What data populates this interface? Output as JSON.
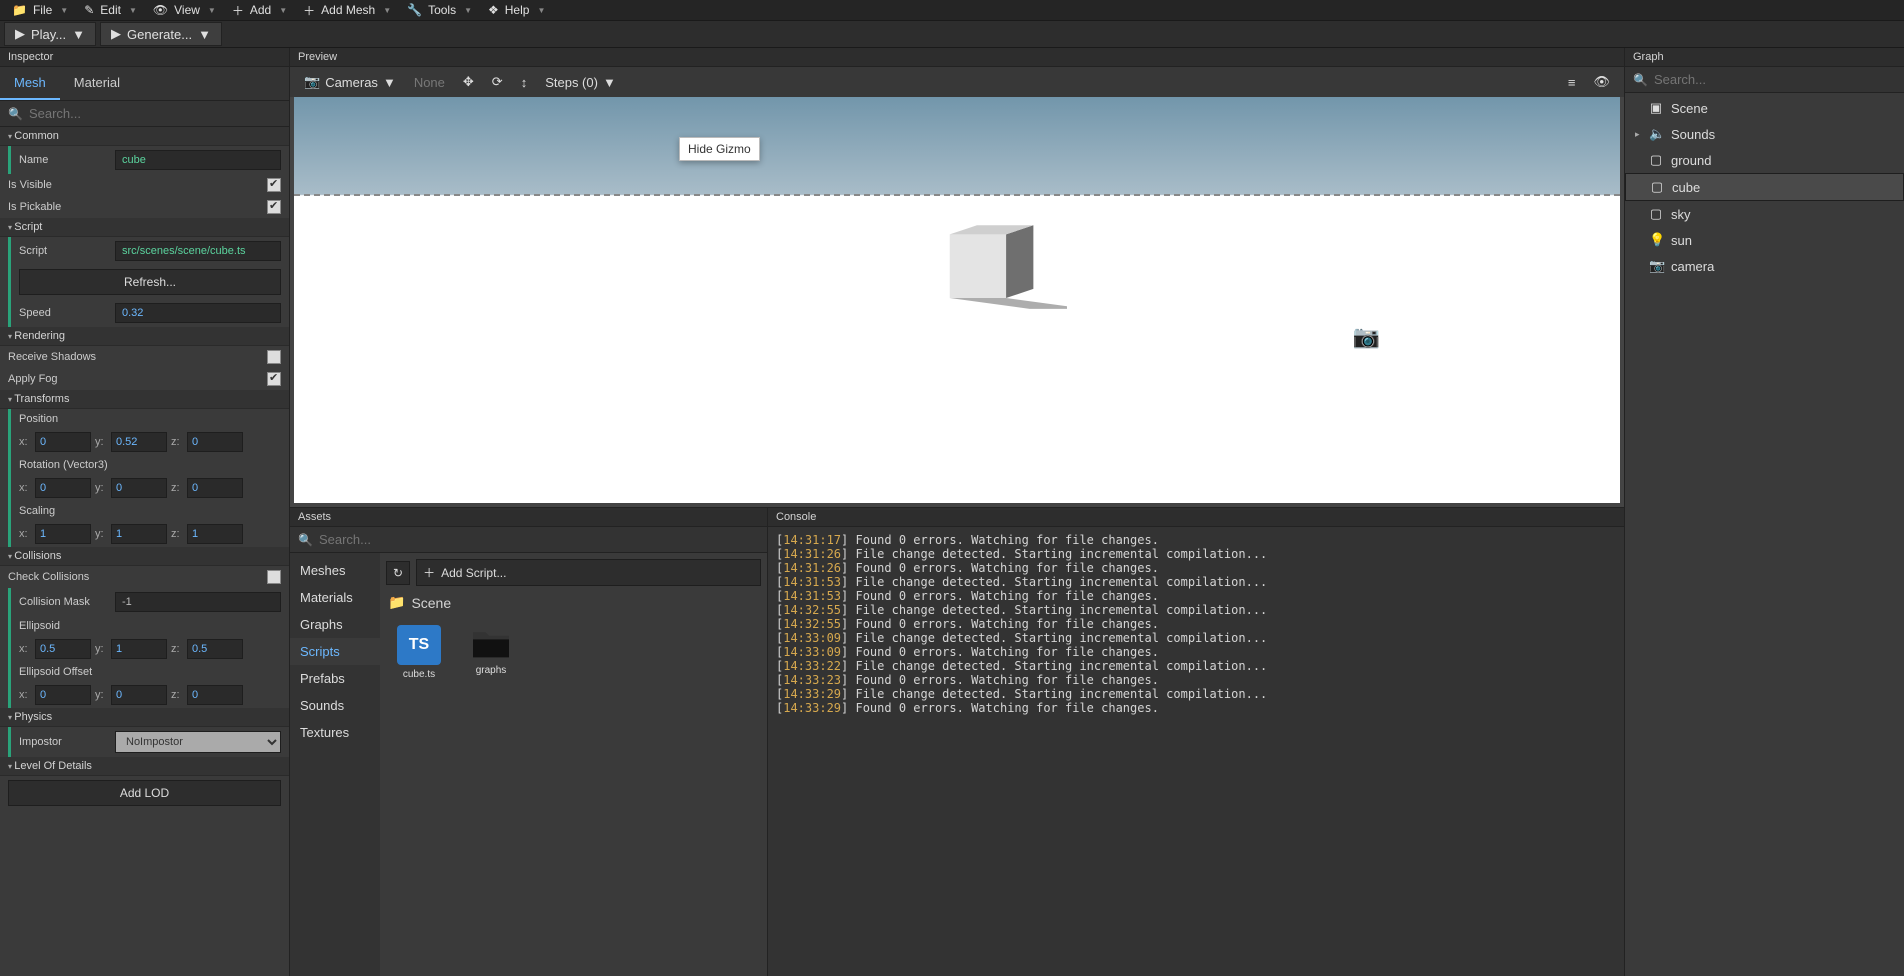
{
  "menu": {
    "file": "File",
    "edit": "Edit",
    "view": "View",
    "add": "Add",
    "addMesh": "Add Mesh",
    "tools": "Tools",
    "help": "Help",
    "play": "Play...",
    "generate": "Generate..."
  },
  "inspector": {
    "title": "Inspector",
    "tabs": {
      "mesh": "Mesh",
      "material": "Material"
    },
    "search": "Search...",
    "common": {
      "h": "Common",
      "name_l": "Name",
      "name": "cube",
      "isVisible": "Is Visible",
      "isPickable": "Is Pickable"
    },
    "script": {
      "h": "Script",
      "script_l": "Script",
      "script": "src/scenes/scene/cube.ts",
      "refresh": "Refresh...",
      "speed_l": "Speed",
      "speed": "0.32"
    },
    "rendering": {
      "h": "Rendering",
      "recvShadows": "Receive Shadows",
      "applyFog": "Apply Fog"
    },
    "transforms": {
      "h": "Transforms",
      "position": "Position",
      "rotation": "Rotation (Vector3)",
      "scaling": "Scaling",
      "pos": {
        "x": "0",
        "y": "0.52",
        "z": "0"
      },
      "rot": {
        "x": "0",
        "y": "0",
        "z": "0"
      },
      "scl": {
        "x": "1",
        "y": "1",
        "z": "1"
      }
    },
    "collisions": {
      "h": "Collisions",
      "check": "Check Collisions",
      "mask_l": "Collision Mask",
      "mask": "-1",
      "ellipsoid": "Ellipsoid",
      "ellipsoidOff": "Ellipsoid Offset",
      "ell": {
        "x": "0.5",
        "y": "1",
        "z": "0.5"
      },
      "elo": {
        "x": "0",
        "y": "0",
        "z": "0"
      }
    },
    "physics": {
      "h": "Physics",
      "impostor_l": "Impostor",
      "impostor": "NoImpostor"
    },
    "lod": {
      "h": "Level Of Details",
      "add": "Add LOD"
    }
  },
  "preview": {
    "title": "Preview",
    "cameras": "Cameras",
    "none": "None",
    "steps": "Steps (0)",
    "tooltip": "Hide Gizmo"
  },
  "assets": {
    "title": "Assets",
    "search": "Search...",
    "refresh": "↻",
    "addScript": "Add Script...",
    "cats": [
      "Meshes",
      "Materials",
      "Graphs",
      "Scripts",
      "Prefabs",
      "Sounds",
      "Textures"
    ],
    "breadcrumb": "Scene",
    "items": [
      {
        "name": "cube.ts",
        "type": "ts"
      },
      {
        "name": "graphs",
        "type": "folder"
      }
    ]
  },
  "console": {
    "title": "Console",
    "lines": [
      {
        "t": "14:31:17",
        "m": "Found 0 errors. Watching for file changes."
      },
      {
        "t": "14:31:26",
        "m": "File change detected. Starting incremental compilation..."
      },
      {
        "t": "14:31:26",
        "m": "Found 0 errors. Watching for file changes."
      },
      {
        "t": "14:31:53",
        "m": "File change detected. Starting incremental compilation..."
      },
      {
        "t": "14:31:53",
        "m": "Found 0 errors. Watching for file changes."
      },
      {
        "t": "14:32:55",
        "m": "File change detected. Starting incremental compilation..."
      },
      {
        "t": "14:32:55",
        "m": "Found 0 errors. Watching for file changes."
      },
      {
        "t": "14:33:09",
        "m": "File change detected. Starting incremental compilation..."
      },
      {
        "t": "14:33:09",
        "m": "Found 0 errors. Watching for file changes."
      },
      {
        "t": "14:33:22",
        "m": "File change detected. Starting incremental compilation..."
      },
      {
        "t": "14:33:23",
        "m": "Found 0 errors. Watching for file changes."
      },
      {
        "t": "14:33:29",
        "m": "File change detected. Starting incremental compilation..."
      },
      {
        "t": "14:33:29",
        "m": "Found 0 errors. Watching for file changes."
      }
    ]
  },
  "graph": {
    "title": "Graph",
    "search": "Search...",
    "items": [
      {
        "icon": "scene",
        "label": "Scene"
      },
      {
        "icon": "sound",
        "label": "Sounds",
        "hasCh": true
      },
      {
        "icon": "mesh",
        "label": "ground"
      },
      {
        "icon": "mesh",
        "label": "cube",
        "sel": true
      },
      {
        "icon": "mesh",
        "label": "sky"
      },
      {
        "icon": "light",
        "label": "sun"
      },
      {
        "icon": "camera",
        "label": "camera"
      }
    ]
  }
}
